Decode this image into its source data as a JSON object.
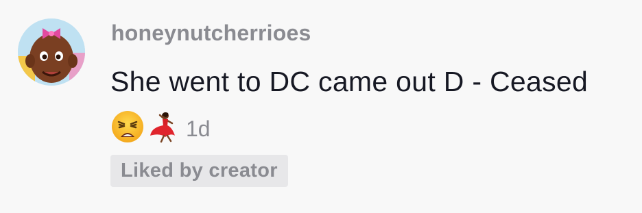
{
  "comment": {
    "avatar_icon": "user-avatar",
    "username": "honeynutcherrioes",
    "text": "She went to DC came out D - Ceased",
    "emojis": [
      "weary-face-emoji",
      "dancer-emoji"
    ],
    "timestamp": "1d",
    "badge": "Liked by creator"
  },
  "colors": {
    "background": "#f8f8f8",
    "username": "#8a8b91",
    "text": "#161823",
    "badge_bg": "#e7e7e9"
  }
}
